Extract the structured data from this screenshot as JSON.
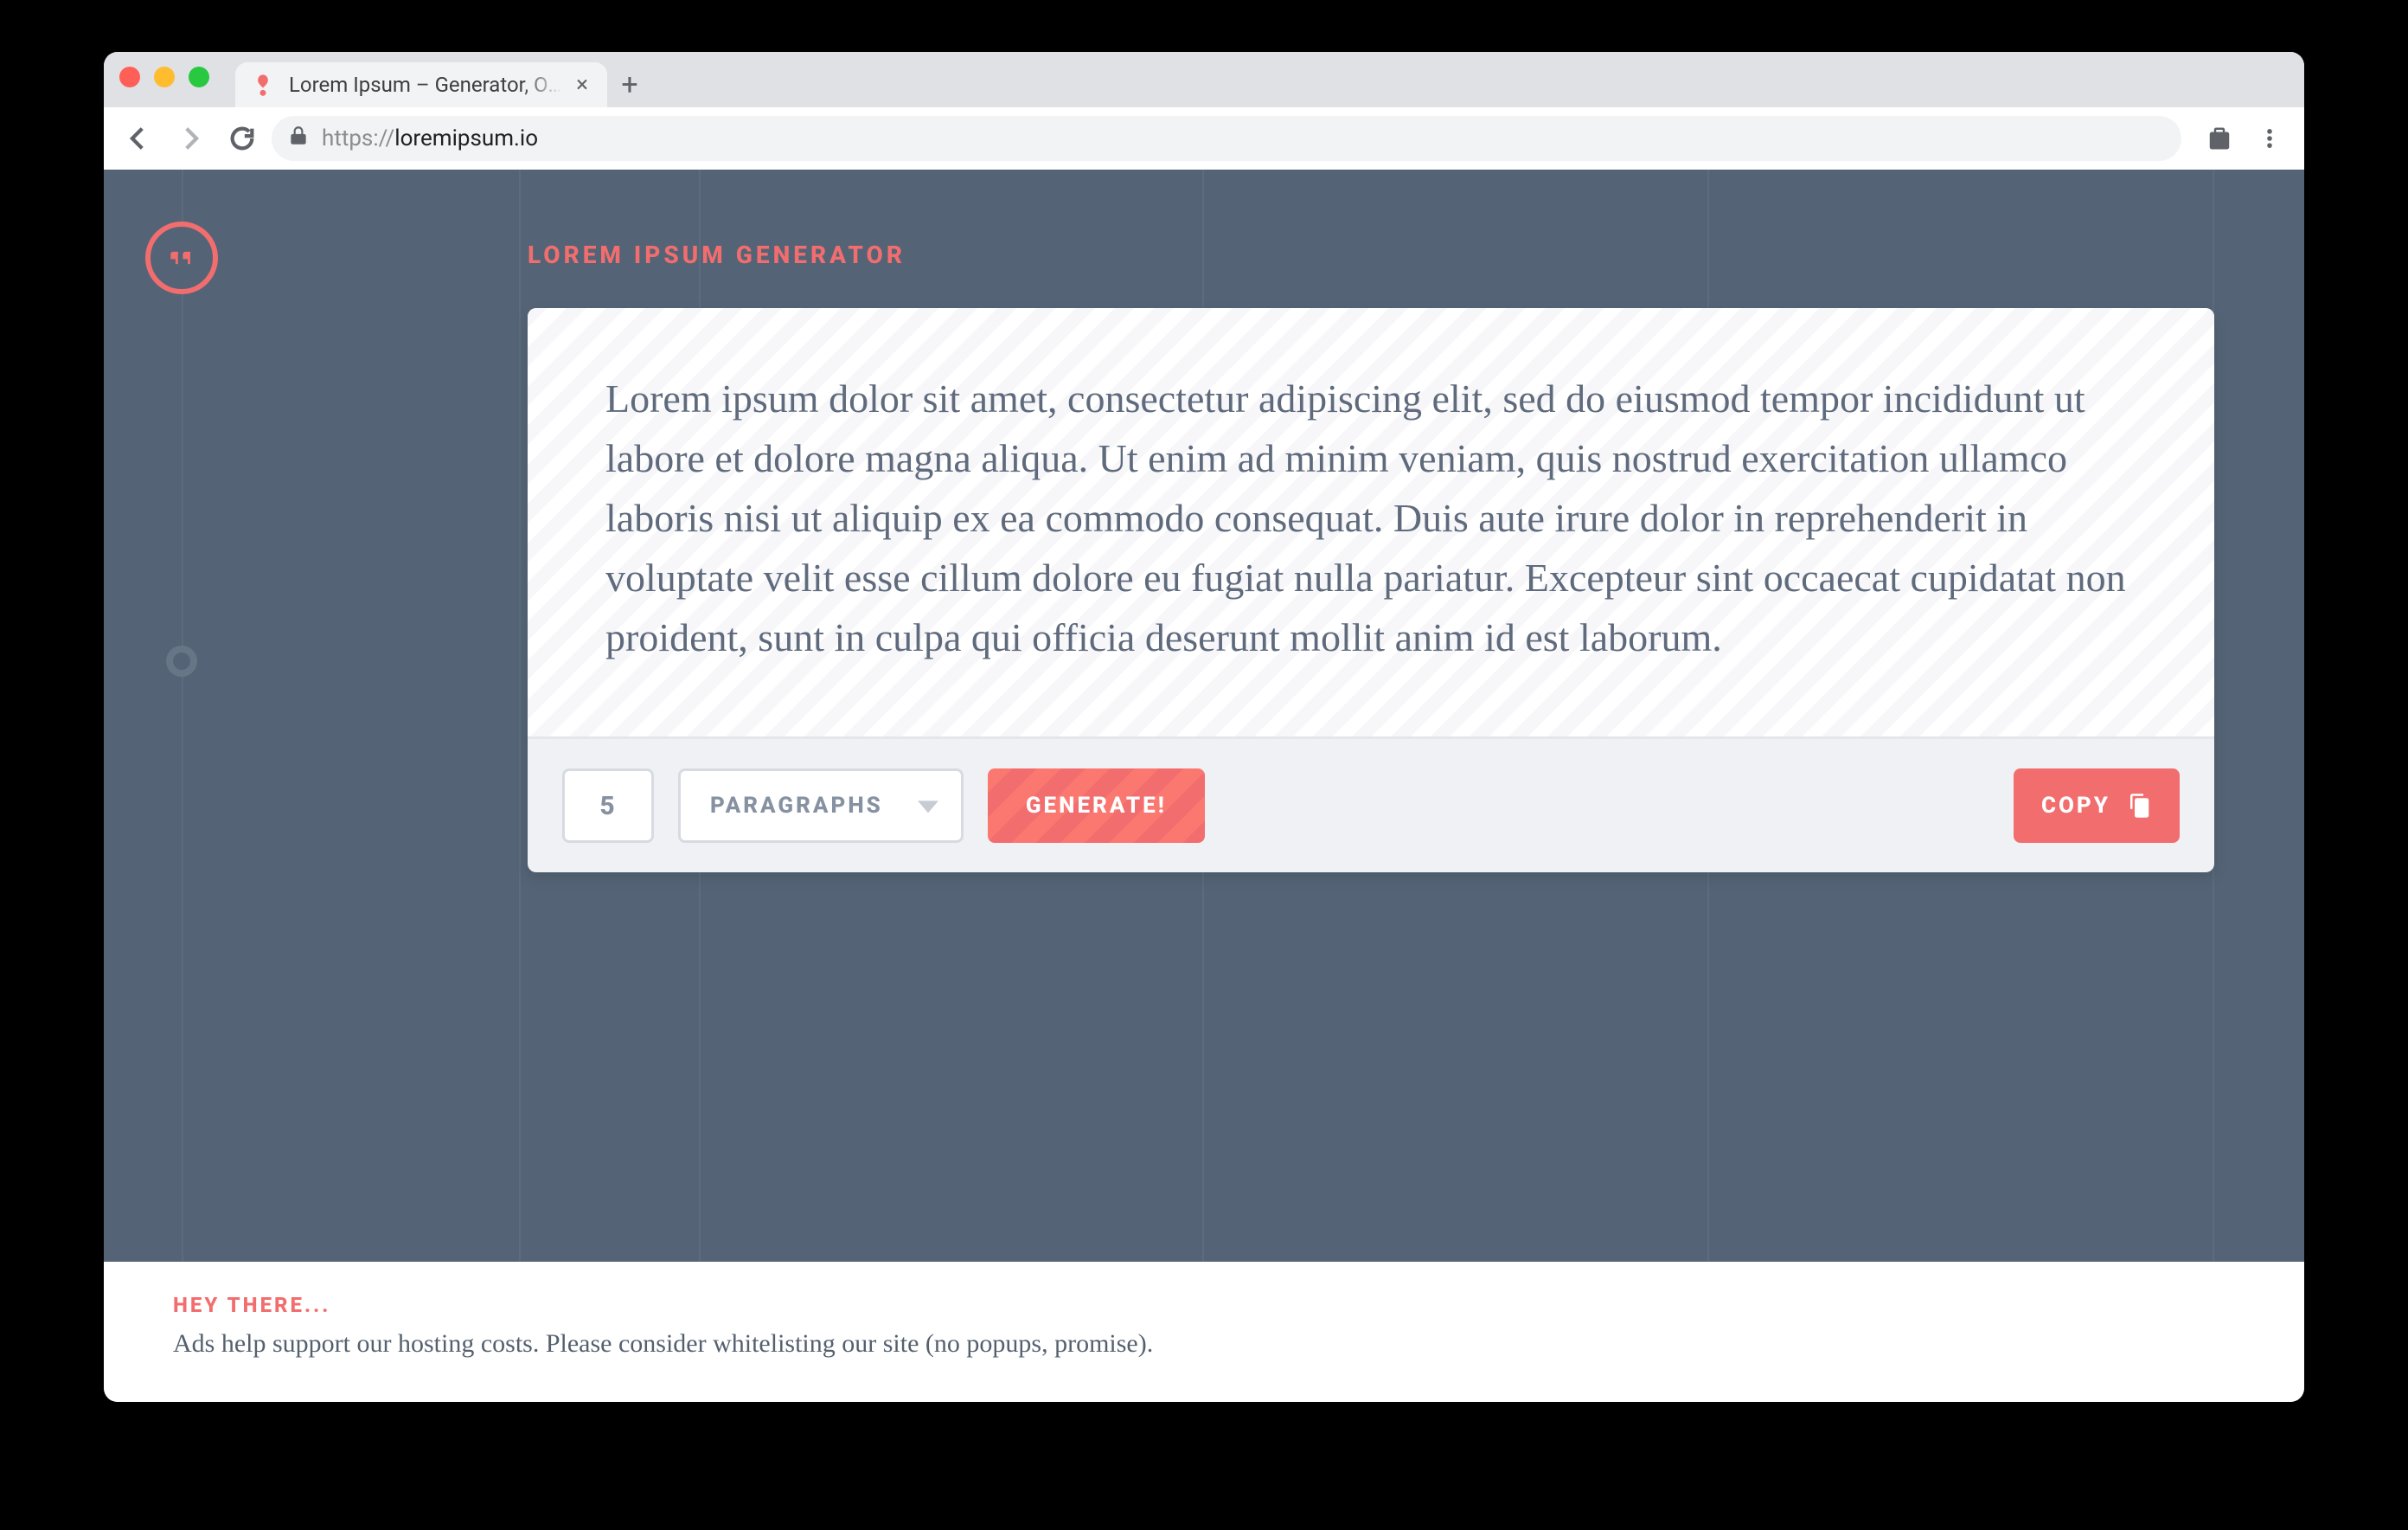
{
  "browser": {
    "tab_title": "Lorem Ipsum – Generator, Orig",
    "new_tab_glyph": "+",
    "close_tab_glyph": "×",
    "url_protocol": "https://",
    "url_host": "loremipsum.io"
  },
  "page": {
    "heading": "LOREM IPSUM GENERATOR",
    "lorem_text": "Lorem ipsum dolor sit amet, consectetur adipiscing elit, sed do eiusmod tempor incididunt ut labore et dolore magna aliqua. Ut enim ad minim veniam, quis nostrud exercitation ullamco laboris nisi ut aliquip ex ea commodo consequat. Duis aute irure dolor in reprehenderit in voluptate velit esse cillum dolore eu fugiat nulla pariatur. Excepteur sint occaecat cupidatat non proident, sunt in culpa qui officia deserunt mollit anim id est laborum.",
    "controls": {
      "quantity_value": "5",
      "type_selected": "PARAGRAPHS",
      "generate_label": "GENERATE!",
      "copy_label": "COPY"
    },
    "ad": {
      "hey": "HEY THERE...",
      "message": "Ads help support our hosting costs. Please consider whitelisting our site (no popups, promise)."
    },
    "colors": {
      "accent": "#f26d6e",
      "page_bg": "#546476"
    }
  }
}
